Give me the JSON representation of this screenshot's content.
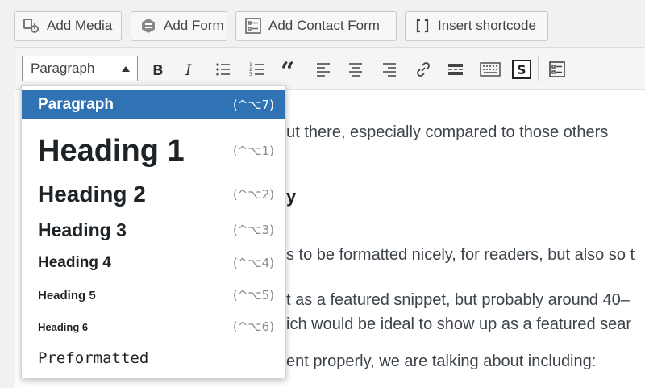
{
  "media_buttons": [
    {
      "label": "Add Media",
      "icon": "media-icon"
    },
    {
      "label": "Add Form",
      "icon": "form-icon"
    },
    {
      "label": "Add Contact Form",
      "icon": "contact-form-icon"
    },
    {
      "label": "Insert shortcode",
      "icon": "shortcode-icon"
    }
  ],
  "toolbar": {
    "format_value": "Paragraph",
    "buttons": [
      "bold-icon",
      "italic-icon",
      "bulleted-list-icon",
      "numbered-list-icon",
      "blockquote-icon",
      "align-left-icon",
      "align-center-icon",
      "align-right-icon",
      "link-icon",
      "read-more-icon",
      "toolbar-toggle-icon",
      "shortcode-s-icon",
      "form-insert-icon"
    ]
  },
  "format_options": [
    {
      "label": "Paragraph",
      "shortcut": "(^⌥7)",
      "active": true
    },
    {
      "label": "Heading 1",
      "shortcut": "(^⌥1)"
    },
    {
      "label": "Heading 2",
      "shortcut": "(^⌥2)"
    },
    {
      "label": "Heading 3",
      "shortcut": "(^⌥3)"
    },
    {
      "label": "Heading 4",
      "shortcut": "(^⌥4)"
    },
    {
      "label": "Heading 5",
      "shortcut": "(^⌥5)"
    },
    {
      "label": "Heading 6",
      "shortcut": "(^⌥6)"
    },
    {
      "label": "Preformatted",
      "shortcut": ""
    }
  ],
  "content_lines": [
    "out there, especially compared to those others",
    "y",
    "s to be formatted nicely, for readers, but also so t",
    "t as a featured snippet, but probably around 40–",
    "ich would be ideal to show up as a featured sear",
    "ent properly, we are talking about including:"
  ]
}
